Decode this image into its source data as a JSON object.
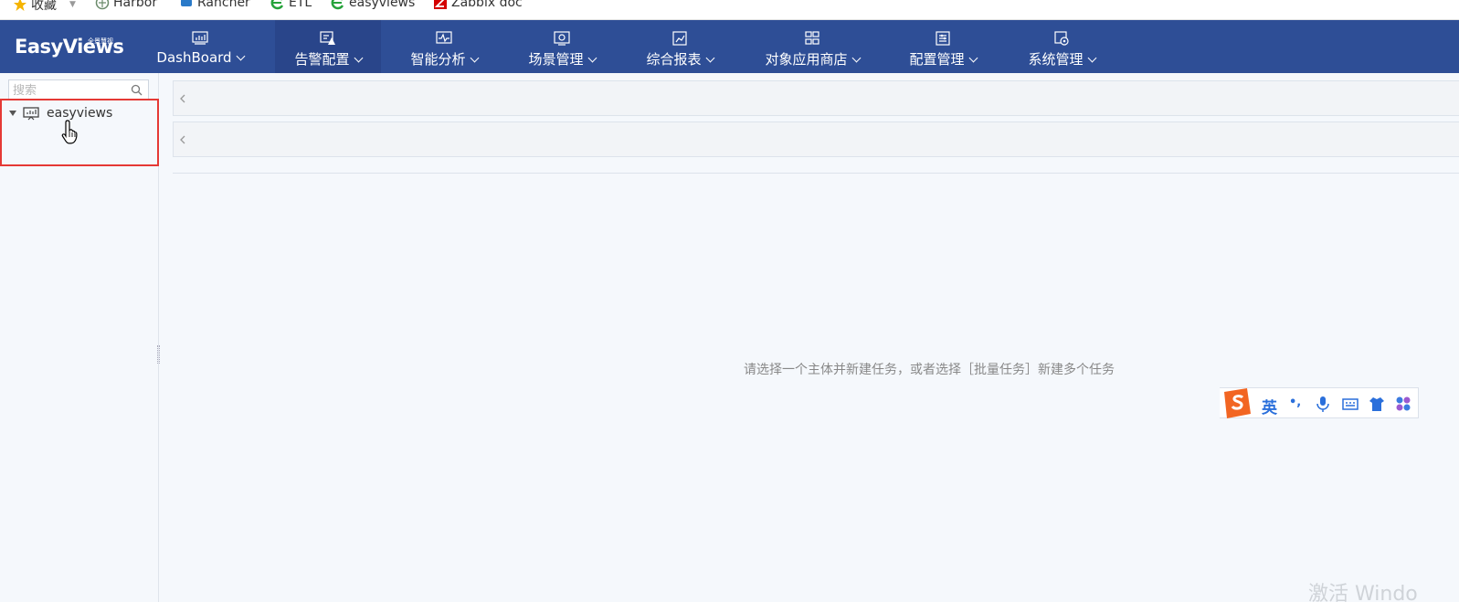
{
  "bookmarks": [
    {
      "label": "收藏",
      "icon": "star-icon"
    },
    {
      "label": "Harbor",
      "icon": "harbor-icon"
    },
    {
      "label": "Rancher",
      "icon": "rancher-icon"
    },
    {
      "label": "ETL",
      "icon": "e-browser-icon"
    },
    {
      "label": "easyviews",
      "icon": "e-browser-icon"
    },
    {
      "label": "Zabbix doc",
      "icon": "zabbix-icon"
    }
  ],
  "logo": {
    "text": "EasyViews",
    "sub": "全景慧视"
  },
  "nav": [
    {
      "label": "DashBoard",
      "icon": "dashboard-chart-icon",
      "active": false
    },
    {
      "label": "告警配置",
      "icon": "alert-config-icon",
      "active": true
    },
    {
      "label": "智能分析",
      "icon": "analysis-pulse-icon",
      "active": false
    },
    {
      "label": "场景管理",
      "icon": "scene-screen-icon",
      "active": false
    },
    {
      "label": "综合报表",
      "icon": "report-icon",
      "active": false
    },
    {
      "label": "对象应用商店",
      "icon": "app-store-grid-icon",
      "active": false
    },
    {
      "label": "配置管理",
      "icon": "config-sliders-icon",
      "active": false
    },
    {
      "label": "系统管理",
      "icon": "system-settings-icon",
      "active": false
    }
  ],
  "sidebar": {
    "search_placeholder": "搜索",
    "tree": [
      {
        "label": "easyviews",
        "expanded": true
      }
    ]
  },
  "main": {
    "empty_message": "请选择一个主体并新建任务，或者选择［批量任务］新建多个任务"
  },
  "ime": {
    "lang": "英",
    "punct": "•,"
  },
  "watermark": "激活 Windo",
  "colors": {
    "nav_bg": "#2e4e96",
    "nav_active": "#29458a",
    "highlight": "#e53935",
    "ime_orange": "#f26522"
  }
}
